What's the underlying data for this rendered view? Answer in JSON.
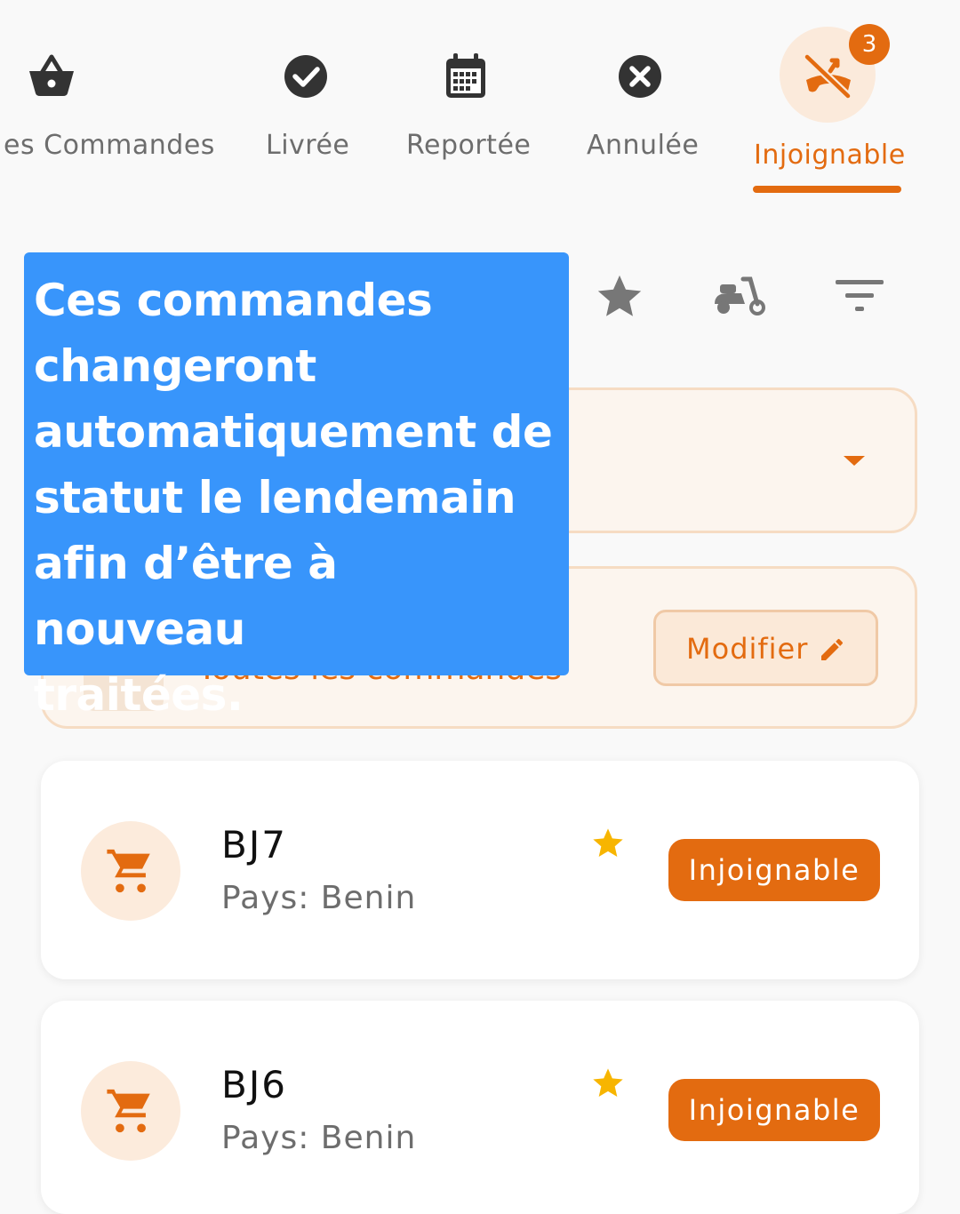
{
  "tabs": [
    {
      "label": "es Commandes",
      "icon": "basket-icon"
    },
    {
      "label": "Livrée",
      "icon": "check-circle-icon"
    },
    {
      "label": "Reportée",
      "icon": "calendar-icon"
    },
    {
      "label": "Annulée",
      "icon": "cancel-circle-icon"
    },
    {
      "label": "Injoignable",
      "icon": "phone-missed-icon",
      "badge": "3",
      "active": true
    }
  ],
  "toolbar": {
    "icons": [
      "star-icon",
      "scooter-icon",
      "filter-icon"
    ]
  },
  "tooltip": {
    "lines": [
      "Ces commandes",
      "changeront",
      "automatiquement de",
      "statut le lendemain",
      "afin d’être à nouveau",
      "traitées."
    ]
  },
  "filter": {
    "label": "Toutes les commandes",
    "modify_label": "Modifier"
  },
  "orders": [
    {
      "code": "BJ7",
      "country": "Pays: Benin",
      "status": "Injoignable"
    },
    {
      "code": "BJ6",
      "country": "Pays: Benin",
      "status": "Injoignable"
    }
  ],
  "colors": {
    "accent": "#e36b10",
    "tooltip": "#3895fb",
    "star": "#f7b500",
    "text_muted": "#6d6d6d"
  }
}
